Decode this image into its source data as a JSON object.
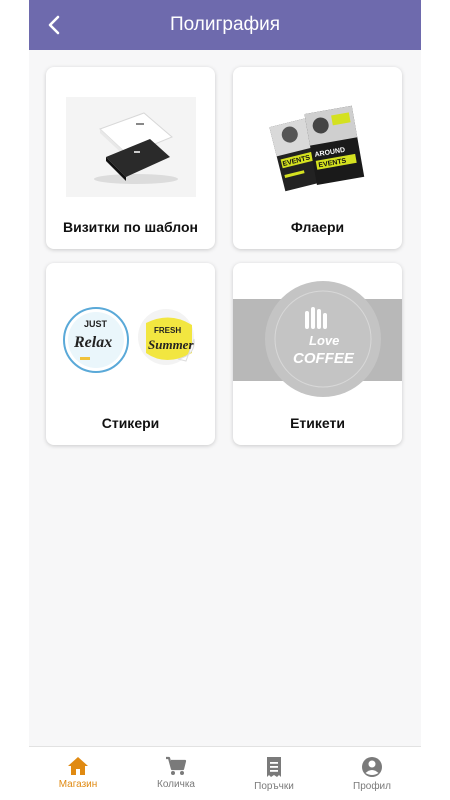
{
  "header": {
    "title": "Полиграфия",
    "back_icon": "arrow-back-icon"
  },
  "categories": [
    {
      "label": "Визитки по шаблон",
      "image": "business-cards-image"
    },
    {
      "label": "Флаери",
      "image": "flyers-image"
    },
    {
      "label": "Стикери",
      "image": "stickers-image",
      "sticker_texts": [
        "JUST",
        "Relax",
        "FRESH",
        "Summer"
      ]
    },
    {
      "label": "Етикети",
      "image": "labels-image",
      "label_texts": [
        "Love",
        "COFFEE"
      ]
    }
  ],
  "flyer_texts": [
    "EVENTS",
    "AROUND",
    "EVENTS"
  ],
  "bottom_nav": [
    {
      "label": "Магазин",
      "icon": "home-icon",
      "active": true
    },
    {
      "label": "Количка",
      "icon": "cart-icon",
      "active": false
    },
    {
      "label": "Поръчки",
      "icon": "receipt-icon",
      "active": false
    },
    {
      "label": "Профил",
      "icon": "profile-icon",
      "active": false
    }
  ],
  "colors": {
    "header": "#6e6aad",
    "active": "#e08a12",
    "inactive": "#7a7a7a",
    "background": "#f7f7f8"
  }
}
